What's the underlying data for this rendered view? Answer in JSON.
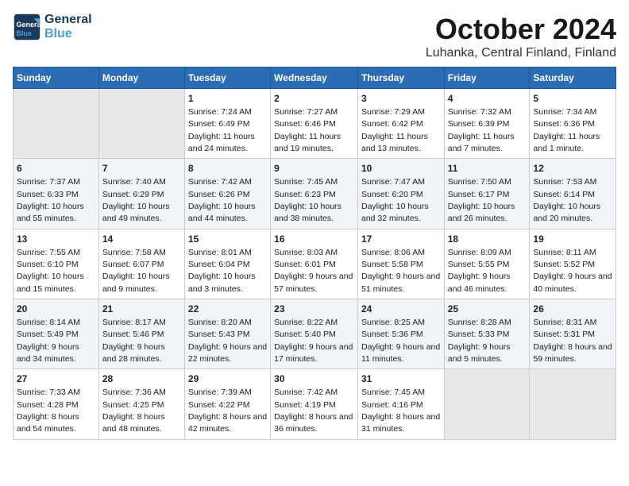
{
  "logo": {
    "line1": "General",
    "line2": "Blue"
  },
  "title": "October 2024",
  "subtitle": "Luhanka, Central Finland, Finland",
  "headers": [
    "Sunday",
    "Monday",
    "Tuesday",
    "Wednesday",
    "Thursday",
    "Friday",
    "Saturday"
  ],
  "weeks": [
    [
      {
        "day": "",
        "info": ""
      },
      {
        "day": "",
        "info": ""
      },
      {
        "day": "1",
        "info": "Sunrise: 7:24 AM\nSunset: 6:49 PM\nDaylight: 11 hours and 24 minutes."
      },
      {
        "day": "2",
        "info": "Sunrise: 7:27 AM\nSunset: 6:46 PM\nDaylight: 11 hours and 19 minutes."
      },
      {
        "day": "3",
        "info": "Sunrise: 7:29 AM\nSunset: 6:42 PM\nDaylight: 11 hours and 13 minutes."
      },
      {
        "day": "4",
        "info": "Sunrise: 7:32 AM\nSunset: 6:39 PM\nDaylight: 11 hours and 7 minutes."
      },
      {
        "day": "5",
        "info": "Sunrise: 7:34 AM\nSunset: 6:36 PM\nDaylight: 11 hours and 1 minute."
      }
    ],
    [
      {
        "day": "6",
        "info": "Sunrise: 7:37 AM\nSunset: 6:33 PM\nDaylight: 10 hours and 55 minutes."
      },
      {
        "day": "7",
        "info": "Sunrise: 7:40 AM\nSunset: 6:29 PM\nDaylight: 10 hours and 49 minutes."
      },
      {
        "day": "8",
        "info": "Sunrise: 7:42 AM\nSunset: 6:26 PM\nDaylight: 10 hours and 44 minutes."
      },
      {
        "day": "9",
        "info": "Sunrise: 7:45 AM\nSunset: 6:23 PM\nDaylight: 10 hours and 38 minutes."
      },
      {
        "day": "10",
        "info": "Sunrise: 7:47 AM\nSunset: 6:20 PM\nDaylight: 10 hours and 32 minutes."
      },
      {
        "day": "11",
        "info": "Sunrise: 7:50 AM\nSunset: 6:17 PM\nDaylight: 10 hours and 26 minutes."
      },
      {
        "day": "12",
        "info": "Sunrise: 7:53 AM\nSunset: 6:14 PM\nDaylight: 10 hours and 20 minutes."
      }
    ],
    [
      {
        "day": "13",
        "info": "Sunrise: 7:55 AM\nSunset: 6:10 PM\nDaylight: 10 hours and 15 minutes."
      },
      {
        "day": "14",
        "info": "Sunrise: 7:58 AM\nSunset: 6:07 PM\nDaylight: 10 hours and 9 minutes."
      },
      {
        "day": "15",
        "info": "Sunrise: 8:01 AM\nSunset: 6:04 PM\nDaylight: 10 hours and 3 minutes."
      },
      {
        "day": "16",
        "info": "Sunrise: 8:03 AM\nSunset: 6:01 PM\nDaylight: 9 hours and 57 minutes."
      },
      {
        "day": "17",
        "info": "Sunrise: 8:06 AM\nSunset: 5:58 PM\nDaylight: 9 hours and 51 minutes."
      },
      {
        "day": "18",
        "info": "Sunrise: 8:09 AM\nSunset: 5:55 PM\nDaylight: 9 hours and 46 minutes."
      },
      {
        "day": "19",
        "info": "Sunrise: 8:11 AM\nSunset: 5:52 PM\nDaylight: 9 hours and 40 minutes."
      }
    ],
    [
      {
        "day": "20",
        "info": "Sunrise: 8:14 AM\nSunset: 5:49 PM\nDaylight: 9 hours and 34 minutes."
      },
      {
        "day": "21",
        "info": "Sunrise: 8:17 AM\nSunset: 5:46 PM\nDaylight: 9 hours and 28 minutes."
      },
      {
        "day": "22",
        "info": "Sunrise: 8:20 AM\nSunset: 5:43 PM\nDaylight: 9 hours and 22 minutes."
      },
      {
        "day": "23",
        "info": "Sunrise: 8:22 AM\nSunset: 5:40 PM\nDaylight: 9 hours and 17 minutes."
      },
      {
        "day": "24",
        "info": "Sunrise: 8:25 AM\nSunset: 5:36 PM\nDaylight: 9 hours and 11 minutes."
      },
      {
        "day": "25",
        "info": "Sunrise: 8:28 AM\nSunset: 5:33 PM\nDaylight: 9 hours and 5 minutes."
      },
      {
        "day": "26",
        "info": "Sunrise: 8:31 AM\nSunset: 5:31 PM\nDaylight: 8 hours and 59 minutes."
      }
    ],
    [
      {
        "day": "27",
        "info": "Sunrise: 7:33 AM\nSunset: 4:28 PM\nDaylight: 8 hours and 54 minutes."
      },
      {
        "day": "28",
        "info": "Sunrise: 7:36 AM\nSunset: 4:25 PM\nDaylight: 8 hours and 48 minutes."
      },
      {
        "day": "29",
        "info": "Sunrise: 7:39 AM\nSunset: 4:22 PM\nDaylight: 8 hours and 42 minutes."
      },
      {
        "day": "30",
        "info": "Sunrise: 7:42 AM\nSunset: 4:19 PM\nDaylight: 8 hours and 36 minutes."
      },
      {
        "day": "31",
        "info": "Sunrise: 7:45 AM\nSunset: 4:16 PM\nDaylight: 8 hours and 31 minutes."
      },
      {
        "day": "",
        "info": ""
      },
      {
        "day": "",
        "info": ""
      }
    ]
  ]
}
